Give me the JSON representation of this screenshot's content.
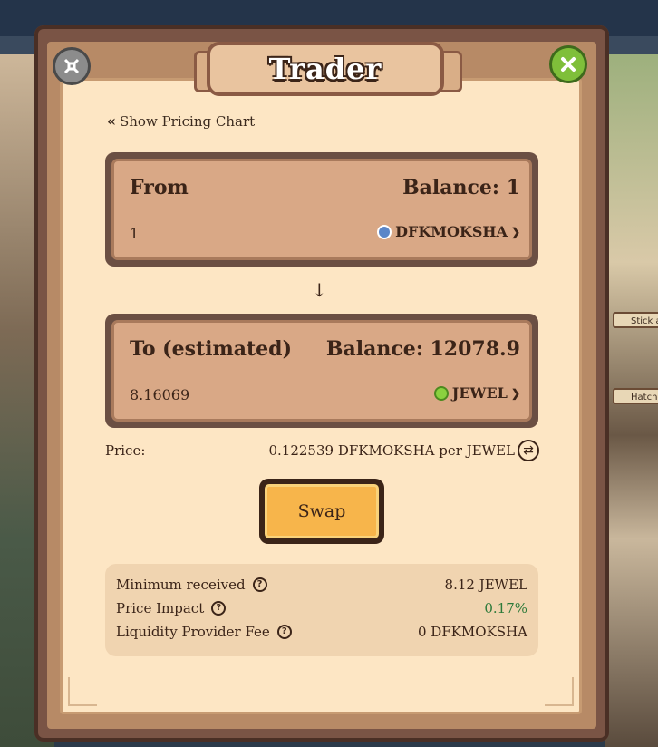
{
  "window": {
    "title": "Trader"
  },
  "nav": {
    "show_chart_label": "Show Pricing Chart"
  },
  "from": {
    "label": "From",
    "balance": "Balance: 1",
    "amount": "1",
    "token": "DFKMOKSHA"
  },
  "to": {
    "label": "To (estimated)",
    "balance": "Balance: 12078.9",
    "amount": "8.16069",
    "token": "JEWEL"
  },
  "price": {
    "label": "Price:",
    "value": "0.122539 DFKMOKSHA per JEWEL"
  },
  "swap": {
    "label": "Swap"
  },
  "stats": {
    "min_received_label": "Minimum received",
    "min_received_value": "8.12 JEWEL",
    "price_impact_label": "Price Impact",
    "price_impact_value": "0.17%",
    "lp_fee_label": "Liquidity Provider Fee",
    "lp_fee_value": "0 DFKMOKSHA"
  },
  "background": {
    "sign1": "Stick a",
    "sign2": "Hatche"
  },
  "colors": {
    "accent": "#f7b54b",
    "positive": "#2d7a3a",
    "close": "#7fbf3a"
  },
  "icons": {
    "close": "close-icon",
    "settings": "settings-icon",
    "refresh": "refresh-icon",
    "help": "question-icon"
  }
}
